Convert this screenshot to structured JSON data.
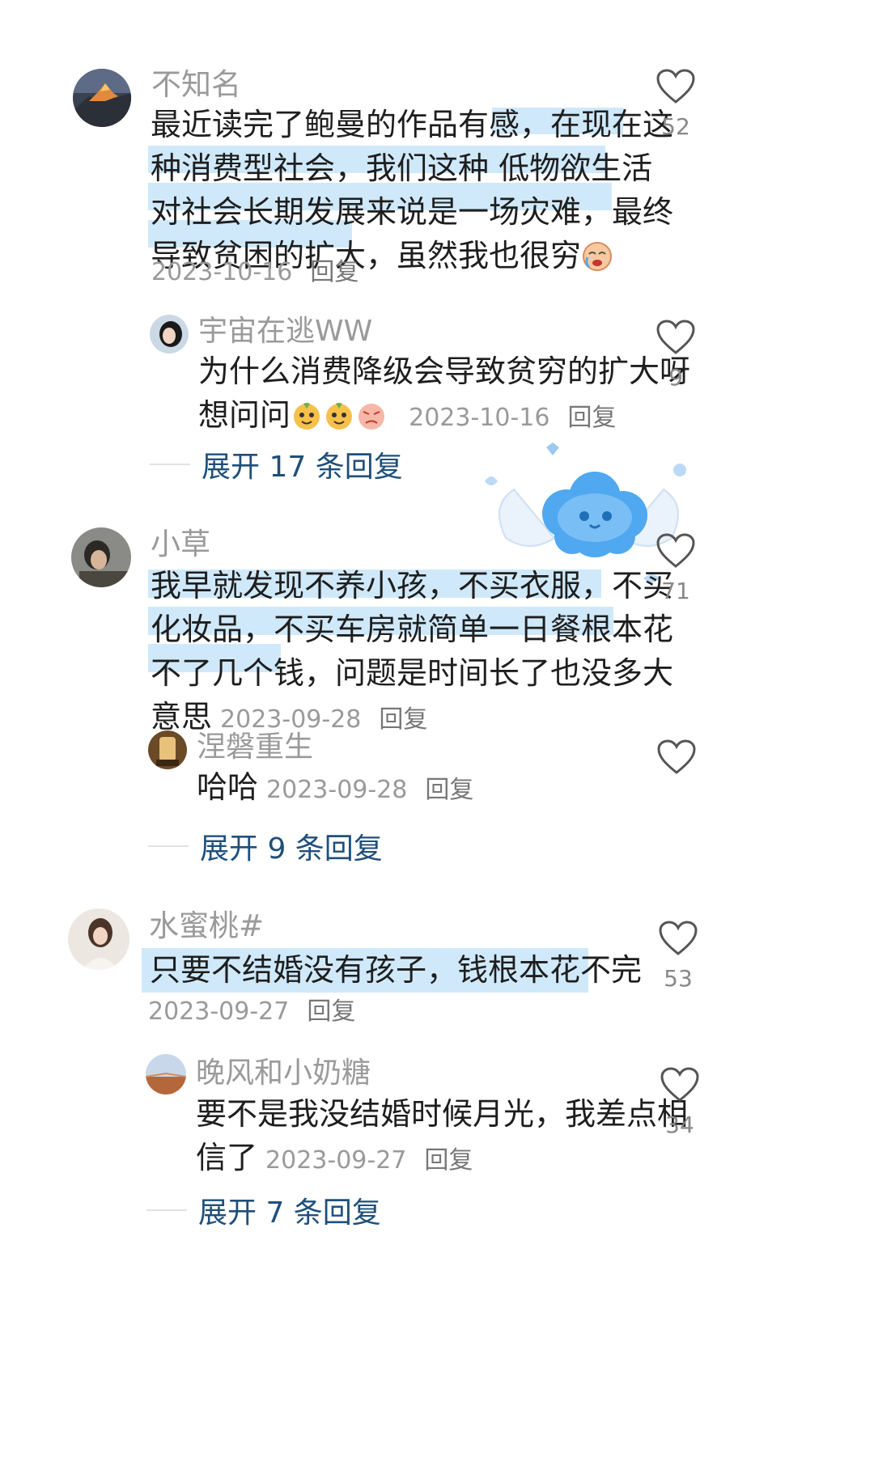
{
  "comments": [
    {
      "username": "不知名",
      "lines": [
        "最近读完了鲍曼的作品有感，在现在这",
        "种消费型社会，我们这种 低物欲生活",
        "对社会长期发展来说是一场灾难，最终",
        "导致贫困的扩大，虽然我也很穷"
      ],
      "date": "2023-10-16",
      "reply_label": "回复",
      "likes": "52",
      "avatar_icon": "mountain-sunset-avatar",
      "emoji": "crying-face-emoji"
    },
    {
      "username": "小草",
      "lines": [
        "我早就发现不养小孩，不买衣服，不买",
        "化妆品，不买车房就简单一日餐根本花",
        "不了几个钱，问题是时间长了也没多大",
        "意思"
      ],
      "date": "2023-09-28",
      "reply_label": "回复",
      "likes": "71",
      "avatar_icon": "person-photo-avatar"
    },
    {
      "username": "水蜜桃#",
      "lines": [
        "只要不结婚没有孩子，钱根本花不完"
      ],
      "date": "2023-09-27",
      "reply_label": "回复",
      "likes": "53",
      "avatar_icon": "woman-photo-avatar"
    }
  ],
  "replies": [
    {
      "username": "宇宙在逃WW",
      "lines": [
        "为什么消费降级会导致贫穷的扩大呀",
        "想问问"
      ],
      "date": "2023-10-16",
      "reply_label": "回复",
      "likes": "9",
      "emojis": [
        "dog-emoji",
        "dog-emoji",
        "angry-face-emoji"
      ]
    },
    {
      "username": "涅磐重生",
      "lines": [
        "哈哈"
      ],
      "date": "2023-09-28",
      "reply_label": "回复",
      "likes": ""
    },
    {
      "username": "晚风和小奶糖",
      "lines": [
        "要不是我没结婚时候月光，我差点相",
        "信了"
      ],
      "date": "2023-09-27",
      "reply_label": "回复",
      "likes": "34"
    }
  ],
  "expand_links": [
    "展开 17 条回复",
    "展开 9 条回复",
    "展开 7 条回复"
  ],
  "colors": {
    "highlight": "#aad7f5",
    "username": "#9a9a9a",
    "expand_link": "#1f4f7a",
    "sticker": "#4fa8f0"
  },
  "sticker": "blue-cloud-angel-sticker"
}
